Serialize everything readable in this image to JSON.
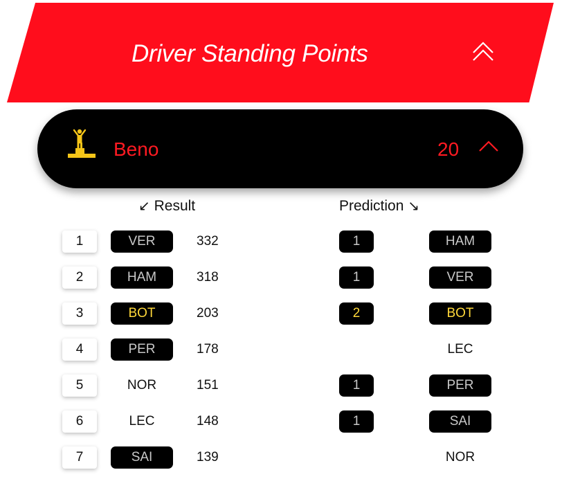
{
  "header": {
    "title": "Driver Standing Points"
  },
  "user": {
    "name": "Beno",
    "points": "20"
  },
  "columns": {
    "result": "Result",
    "prediction": "Prediction"
  },
  "rows": [
    {
      "position": "1",
      "driver": "VER",
      "points": "332",
      "highlight": false,
      "chip": true,
      "pred_num": "1",
      "pred_driver": "HAM",
      "pred_highlight": false,
      "pred_chip": true
    },
    {
      "position": "2",
      "driver": "HAM",
      "points": "318",
      "highlight": false,
      "chip": true,
      "pred_num": "1",
      "pred_driver": "VER",
      "pred_highlight": false,
      "pred_chip": true
    },
    {
      "position": "3",
      "driver": "BOT",
      "points": "203",
      "highlight": true,
      "chip": true,
      "pred_num": "2",
      "pred_driver": "BOT",
      "pred_highlight": true,
      "pred_chip": true
    },
    {
      "position": "4",
      "driver": "PER",
      "points": "178",
      "highlight": false,
      "chip": true,
      "pred_num": "",
      "pred_driver": "LEC",
      "pred_highlight": false,
      "pred_chip": false
    },
    {
      "position": "5",
      "driver": "NOR",
      "points": "151",
      "highlight": false,
      "chip": false,
      "pred_num": "1",
      "pred_driver": "PER",
      "pred_highlight": false,
      "pred_chip": true
    },
    {
      "position": "6",
      "driver": "LEC",
      "points": "148",
      "highlight": false,
      "chip": false,
      "pred_num": "1",
      "pred_driver": "SAI",
      "pred_highlight": false,
      "pred_chip": true
    },
    {
      "position": "7",
      "driver": "SAI",
      "points": "139",
      "highlight": false,
      "chip": true,
      "pred_num": "",
      "pred_driver": "NOR",
      "pred_highlight": false,
      "pred_chip": false
    }
  ],
  "colors": {
    "red": "#ff0d1c",
    "gold": "#ffd83a",
    "chip_text": "#c9c9c9"
  },
  "icons": {
    "collapse": "double-chevron-up-icon",
    "trophy": "podium-icon",
    "chevron": "chevron-up-icon"
  }
}
